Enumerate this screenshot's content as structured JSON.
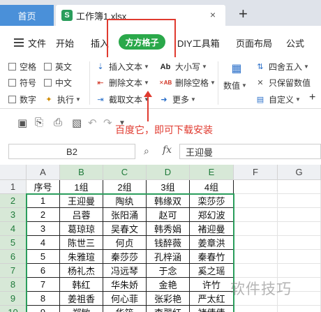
{
  "tabs": {
    "home": "首页",
    "doc": "工作簿1.xlsx",
    "doc_icon": "S",
    "close": "×",
    "new": "+"
  },
  "menu": {
    "file": "文件",
    "start": "开始",
    "insert": "插入",
    "pill": "方方格子",
    "diy": "DIY工具箱",
    "layout": "页面布局",
    "formula": "公式"
  },
  "ribbon": {
    "space": "空格",
    "english": "英文",
    "symbol": "符号",
    "chinese": "中文",
    "number": "数字",
    "execute": "执行",
    "insert_text": "插入文本",
    "delete_text": "删除文本",
    "extract_text": "截取文本",
    "upper_lower": "大小写",
    "delete_space": "删除空格",
    "more": "更多",
    "numeric": "数值",
    "round": "四舍五入",
    "keep_value": "只保留数值",
    "custom": "自定义",
    "icon_ab": "Ab",
    "icon_xab": "✕AB",
    "icon_plus": "+"
  },
  "annotation": "百度它，即可下载安装",
  "formula_bar": {
    "name_box": "B2",
    "fx": "fx",
    "value": "王迎曼"
  },
  "columns": [
    "A",
    "B",
    "C",
    "D",
    "E",
    "F",
    "G"
  ],
  "rows": [
    "1",
    "2",
    "3",
    "4",
    "5",
    "6",
    "7",
    "8",
    "9",
    "10"
  ],
  "table": {
    "header": [
      "序号",
      "1组",
      "2组",
      "3组",
      "4组"
    ],
    "data": [
      [
        "1",
        "王迎曼",
        "陶纨",
        "韩缘双",
        "栾莎莎"
      ],
      [
        "2",
        "吕蓉",
        "张阳涌",
        "赵可",
        "郑幻波"
      ],
      [
        "3",
        "葛琼琼",
        "吴春文",
        "韩秀娟",
        "褚迎曼"
      ],
      [
        "4",
        "陈世三",
        "何贞",
        "钱醉薇",
        "姜章洪"
      ],
      [
        "5",
        "朱雅瑄",
        "秦莎莎",
        "孔梓涵",
        "秦春竹"
      ],
      [
        "6",
        "杨礼杰",
        "冯远琴",
        "于念",
        "奚之瑶"
      ],
      [
        "7",
        "韩红",
        "华朱娇",
        "金艳",
        "许竹"
      ],
      [
        "8",
        "姜祖香",
        "何心菲",
        "张彩艳",
        "严太红"
      ],
      [
        "9",
        "郑敏",
        "华筠",
        "李翠红",
        "褚倩倩"
      ]
    ]
  },
  "watermark": "软件技巧",
  "colors": {
    "accent_green": "#2aa84a",
    "annotation_red": "#e03a2f",
    "home_tab": "#4a90d9"
  }
}
